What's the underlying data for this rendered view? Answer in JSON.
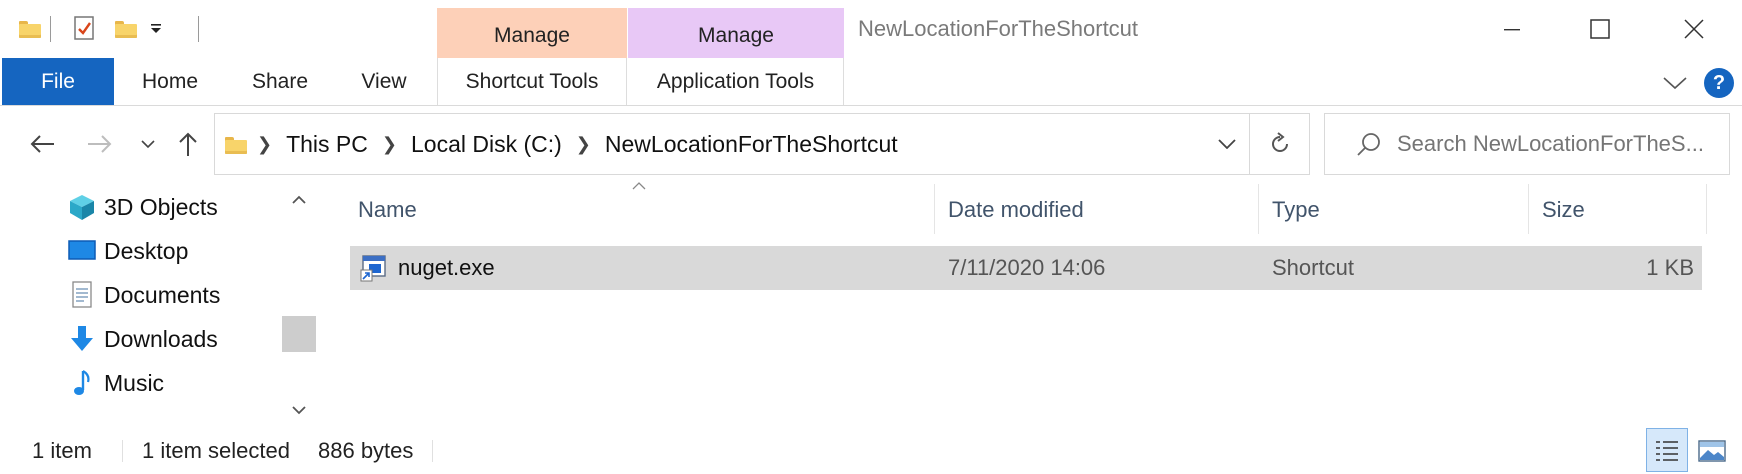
{
  "window": {
    "title": "NewLocationForTheShortcut",
    "accent": "#1565c0"
  },
  "contextual_tabs": {
    "shortcut": {
      "group": "Manage",
      "tab": "Shortcut Tools",
      "color": "#fdd0b8"
    },
    "application": {
      "group": "Manage",
      "tab": "Application Tools",
      "color": "#e8c8f6"
    }
  },
  "ribbon": {
    "tabs": [
      "File",
      "Home",
      "Share",
      "View"
    ]
  },
  "address": {
    "breadcrumbs": [
      "This PC",
      "Local Disk (C:)",
      "NewLocationForTheShortcut"
    ]
  },
  "search": {
    "placeholder": "Search NewLocationForTheS..."
  },
  "navpane": {
    "items": [
      {
        "label": "3D Objects",
        "icon": "3d-objects-icon"
      },
      {
        "label": "Desktop",
        "icon": "desktop-icon"
      },
      {
        "label": "Documents",
        "icon": "documents-icon"
      },
      {
        "label": "Downloads",
        "icon": "downloads-icon"
      },
      {
        "label": "Music",
        "icon": "music-icon"
      }
    ]
  },
  "columns": [
    "Name",
    "Date modified",
    "Type",
    "Size"
  ],
  "files": [
    {
      "name": "nuget.exe",
      "date_modified": "7/11/2020 14:06",
      "type": "Shortcut",
      "size": "1 KB",
      "selected": true
    }
  ],
  "status": {
    "count": "1 item",
    "selection": "1 item selected",
    "size": "886 bytes"
  }
}
